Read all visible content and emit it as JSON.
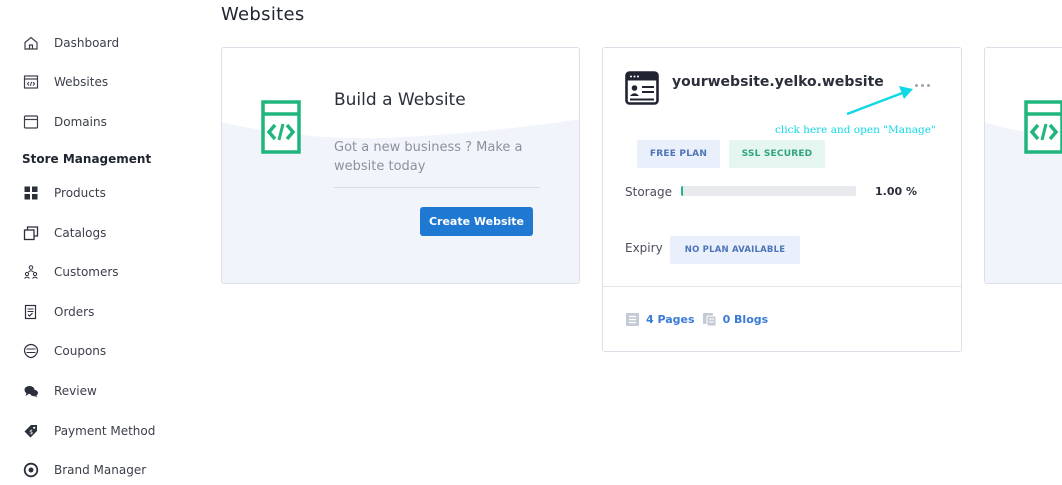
{
  "sidebar": {
    "items_top": [
      {
        "label": "Dashboard",
        "icon": "home-icon"
      },
      {
        "label": "Websites",
        "icon": "code-window-icon"
      },
      {
        "label": "Domains",
        "icon": "browser-window-icon"
      }
    ],
    "section_title": "Store Management",
    "items_store": [
      {
        "label": "Products",
        "icon": "grid-icon"
      },
      {
        "label": "Catalogs",
        "icon": "catalog-icon"
      },
      {
        "label": "Customers",
        "icon": "customers-icon"
      },
      {
        "label": "Orders",
        "icon": "order-clipboard-icon"
      },
      {
        "label": "Coupons",
        "icon": "coupon-icon"
      },
      {
        "label": "Review",
        "icon": "chat-bubbles-icon"
      },
      {
        "label": "Payment Method",
        "icon": "payment-tag-icon"
      },
      {
        "label": "Brand Manager",
        "icon": "target-icon"
      }
    ]
  },
  "page": {
    "title": "Websites"
  },
  "build_card": {
    "title": "Build a Website",
    "description": "Got a new business ? Make a website today",
    "button_label": "Create Website",
    "icon": "code-window-icon"
  },
  "site_card": {
    "name": "yourwebsite.yelko.website",
    "annotation": "click here and open \"Manage\"",
    "badges": {
      "plan": "FREE PLAN",
      "ssl": "SSL SECURED"
    },
    "storage": {
      "label": "Storage",
      "value_text": "1.00 %",
      "fraction": 0.01
    },
    "expiry": {
      "label": "Expiry",
      "value": "NO PLAN AVAILABLE"
    },
    "stats": {
      "pages": "4 Pages",
      "blogs": "0 Blogs"
    }
  },
  "colors": {
    "accent_green": "#1fb57c",
    "button_blue": "#1f78d1",
    "link_blue": "#3a7bd5",
    "annotation_cyan": "#12d8e6"
  }
}
